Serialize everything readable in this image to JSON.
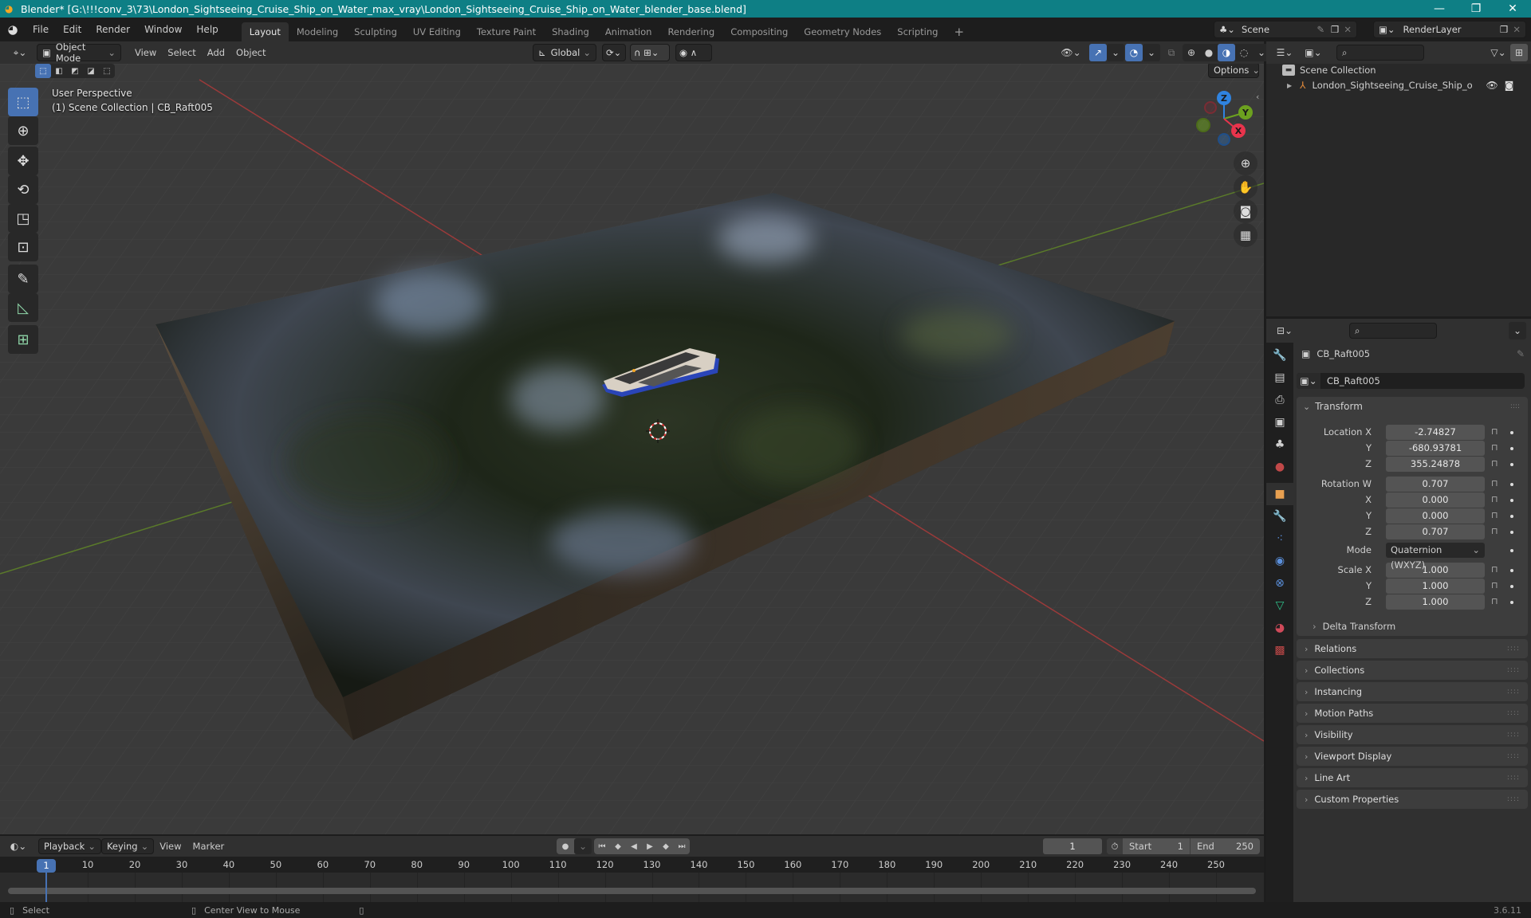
{
  "window": {
    "title": "Blender* [G:\\!!!conv_3\\73\\London_Sightseeing_Cruise_Ship_on_Water_max_vray\\London_Sightseeing_Cruise_Ship_on_Water_blender_base.blend]",
    "minimize": "—",
    "maximize": "❐",
    "close": "✕"
  },
  "menu": [
    "File",
    "Edit",
    "Render",
    "Window",
    "Help"
  ],
  "workspaces": [
    {
      "label": "Layout",
      "active": true
    },
    {
      "label": "Modeling"
    },
    {
      "label": "Sculpting"
    },
    {
      "label": "UV Editing"
    },
    {
      "label": "Texture Paint"
    },
    {
      "label": "Shading"
    },
    {
      "label": "Animation"
    },
    {
      "label": "Rendering"
    },
    {
      "label": "Compositing"
    },
    {
      "label": "Geometry Nodes"
    },
    {
      "label": "Scripting"
    }
  ],
  "add_workspace": "+",
  "scene": {
    "label": "Scene",
    "view_layer": "RenderLayer"
  },
  "viewport_header": {
    "mode": "Object Mode",
    "menus": [
      "View",
      "Select",
      "Add",
      "Object"
    ],
    "orientation": "Global",
    "options": "Options"
  },
  "viewport": {
    "perspective": "User Perspective",
    "collection_info": "(1) Scene Collection | CB_Raft005",
    "gizmo_axes": {
      "x": "X",
      "y": "Y",
      "z": "Z"
    },
    "colors": {
      "x": "#e8344c",
      "y": "#6ca11f",
      "z": "#2f83e0",
      "accent": "#4772b3"
    }
  },
  "outliner": {
    "root": "Scene Collection",
    "items": [
      {
        "label": "London_Sightseeing_Cruise_Ship_on_Wa",
        "type": "empty"
      }
    ]
  },
  "properties": {
    "object_name": "CB_Raft005",
    "datablock_name": "CB_Raft005",
    "transform_label": "Transform",
    "location": {
      "label": "Location X",
      "x": "-2.74827",
      "y": "-680.93781",
      "z": "355.24878"
    },
    "rotation": {
      "label": "Rotation W",
      "w": "0.707",
      "x": "0.000",
      "y": "0.000",
      "z": "0.707"
    },
    "mode": {
      "label": "Mode",
      "value": "Quaternion (WXYZ)"
    },
    "scale": {
      "label": "Scale X",
      "x": "1.000",
      "y": "1.000",
      "z": "1.000"
    },
    "axis_labels": {
      "y": "Y",
      "z": "Z",
      "x": "X"
    },
    "delta_transform": "Delta Transform",
    "panels": [
      "Relations",
      "Collections",
      "Instancing",
      "Motion Paths",
      "Visibility",
      "Viewport Display",
      "Line Art",
      "Custom Properties"
    ]
  },
  "timeline": {
    "menus": [
      "Playback",
      "Keying",
      "View",
      "Marker"
    ],
    "current_frame": "1",
    "start_label": "Start",
    "start": "1",
    "end_label": "End",
    "end": "250",
    "ticks": [
      "10",
      "20",
      "30",
      "40",
      "50",
      "60",
      "70",
      "80",
      "90",
      "100",
      "110",
      "120",
      "130",
      "140",
      "150",
      "160",
      "170",
      "180",
      "190",
      "200",
      "210",
      "220",
      "230",
      "240",
      "250"
    ],
    "playhead": "1"
  },
  "statusbar": {
    "select": "Select",
    "center_view": "Center View to Mouse",
    "version": "3.6.11"
  }
}
